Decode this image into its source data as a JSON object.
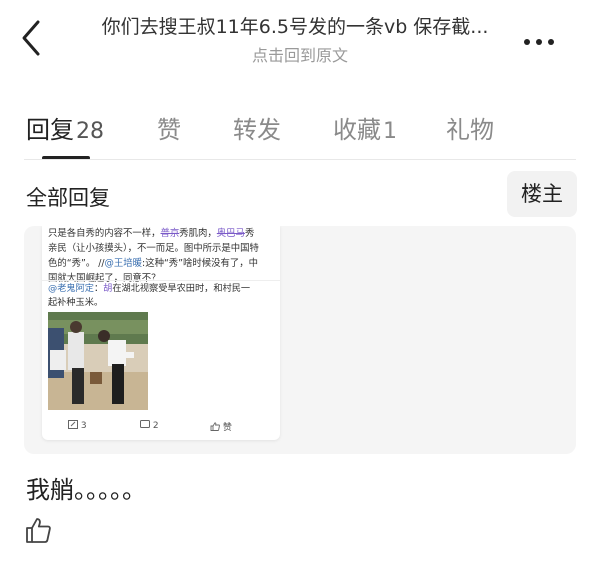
{
  "header": {
    "title": "你们去搜王叔11年6.5号发的一条vb  保存截...",
    "subtitle": "点击回到原文"
  },
  "tabs": [
    {
      "label": "回复",
      "count": "28",
      "active": true
    },
    {
      "label": "赞",
      "count": "",
      "active": false
    },
    {
      "label": "转发",
      "count": "",
      "active": false
    },
    {
      "label": "收藏",
      "count": "1",
      "active": false
    },
    {
      "label": "礼物",
      "count": "",
      "active": false
    }
  ],
  "sort": {
    "all_replies": "全部回复",
    "author_only": "楼主"
  },
  "embedded_post": {
    "line1_a": "只是各自秀的内容不一样，",
    "line1_strike1": "普京",
    "line1_b": "秀肌肉，",
    "line1_strike2": "奥巴马",
    "line1_c": "秀",
    "line2": "亲民（让小孩摸头），不一而足。图中所示是中国特",
    "line3_a": "色的“秀”。 //",
    "line3_mention": "@王培暖",
    "line3_b": ":这种“秀”啥时候没有了，中",
    "line4": "国就大国崛起了，同意不？",
    "repost_mention": "@老鬼阿定",
    "repost_colon": "：",
    "repost_redacted": "胡",
    "repost_text1": "在湖北视察受旱农田时，和村民一",
    "repost_text2": "起补种玉米。",
    "actions": {
      "repost_count": "3",
      "comment_count": "2",
      "like_label": "赞"
    }
  },
  "reply": {
    "text": "我艄。。。。。"
  },
  "colors": {
    "accent": "#222222",
    "muted": "#8a8a8a",
    "quote_bg": "#f5f5f5",
    "mention": "#3a6fb0",
    "strike": "#7a5ac8"
  },
  "icons": {
    "back": "chevron-left-icon",
    "more": "more-dots-icon",
    "like": "thumbs-up-icon",
    "repost": "repost-icon",
    "comment": "comment-icon",
    "embedded_like": "thumbs-up-icon"
  }
}
